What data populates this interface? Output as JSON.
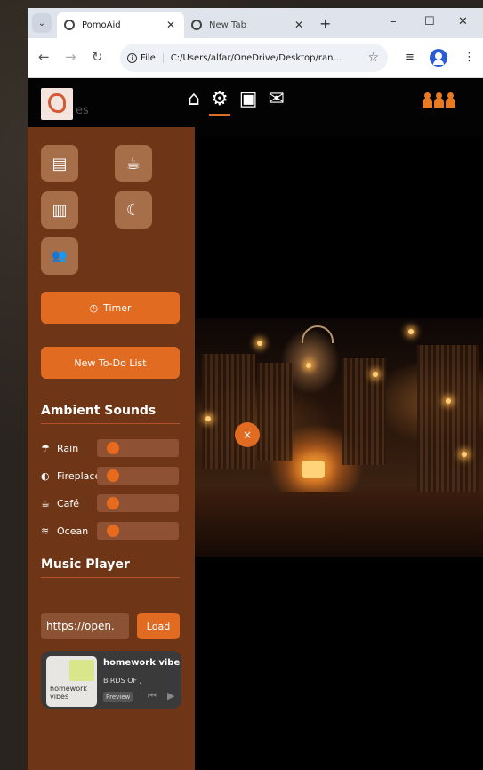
{
  "browser": {
    "tabs": [
      {
        "title": "PomoAid",
        "active": true
      },
      {
        "title": "New Tab",
        "active": false
      }
    ],
    "address_chip": "File",
    "url": "C:/Users/alfar/OneDrive/Desktop/ran...",
    "new_tab_symbol": "+",
    "window_controls": [
      "–",
      "☐",
      "✕"
    ]
  },
  "app": {
    "logo_suffix": "es",
    "nav_icons": [
      "home-icon",
      "gear-icon",
      "book-icon",
      "mail-icon"
    ],
    "active_nav": "gear-icon",
    "accent_color": "#e26b22",
    "sidebar_color": "#6e3516"
  },
  "sidebar": {
    "scene_buttons": [
      {
        "icon": "book-icon",
        "glyph": "▤"
      },
      {
        "icon": "coffee-icon",
        "glyph": "☕"
      },
      {
        "icon": "city-icon",
        "glyph": "▥"
      },
      {
        "icon": "moon-icon",
        "glyph": "☾"
      },
      {
        "icon": "users-icon",
        "glyph": "👥"
      }
    ],
    "timer_label": "Timer",
    "todo_label": "New To-Do List",
    "ambient_title": "Ambient Sounds",
    "sounds": [
      {
        "name": "Rain",
        "icon": "rain-icon",
        "glyph": "☂",
        "level": 0.1
      },
      {
        "name": "Fireplace",
        "icon": "fire-icon",
        "glyph": "◐",
        "level": 0.1
      },
      {
        "name": "Café",
        "icon": "coffee-icon",
        "glyph": "☕",
        "level": 0.1
      },
      {
        "name": "Ocean",
        "icon": "water-icon",
        "glyph": "≋",
        "level": 0.1
      }
    ],
    "music_title": "Music Player",
    "url_value": "https://open.",
    "load_label": "Load",
    "player": {
      "track": "homework vibe",
      "artist": "BIRDS OF ,",
      "cover_text": "homework vibes",
      "preview_label": "Preview"
    }
  },
  "close_symbol": "×"
}
